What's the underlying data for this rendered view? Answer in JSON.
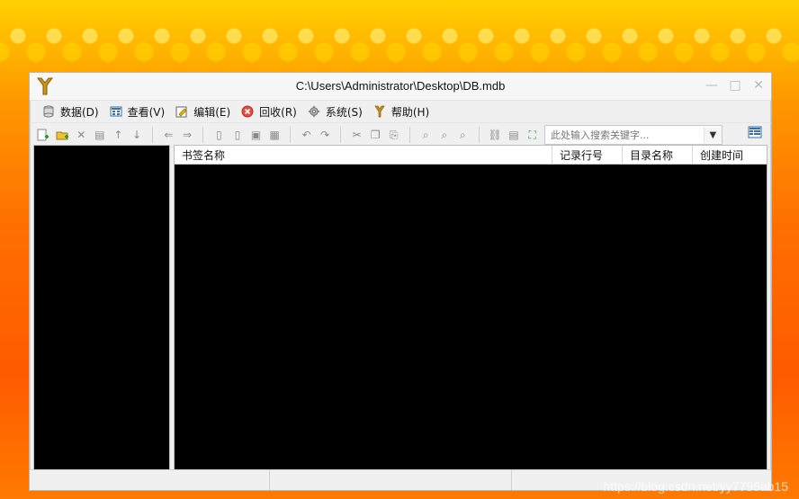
{
  "window": {
    "title": "C:\\Users\\Administrator\\Desktop\\DB.mdb"
  },
  "menu": [
    {
      "label": "数据(D)",
      "icon": "database-icon"
    },
    {
      "label": "查看(V)",
      "icon": "view-icon"
    },
    {
      "label": "编辑(E)",
      "icon": "edit-icon"
    },
    {
      "label": "回收(R)",
      "icon": "recycle-icon"
    },
    {
      "label": "系统(S)",
      "icon": "gear-icon"
    },
    {
      "label": "帮助(H)",
      "icon": "help-icon"
    }
  ],
  "toolbar": {
    "search_placeholder": "此处输入搜索关键字..."
  },
  "table": {
    "headers": [
      "书签名称",
      "记录行号",
      "目录名称",
      "创建时间"
    ]
  },
  "watermark": "https://blog.csdn.net/yy7795ab15"
}
